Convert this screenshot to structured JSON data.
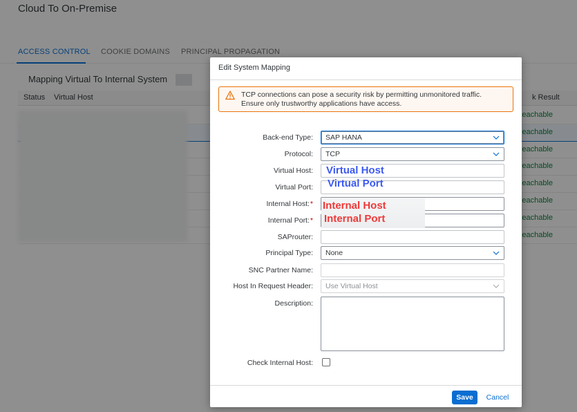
{
  "page": {
    "title": "Cloud To On-Premise",
    "tabs": [
      {
        "label": "ACCESS CONTROL",
        "active": true
      },
      {
        "label": "COOKIE DOMAINS",
        "active": false
      },
      {
        "label": "PRINCIPAL PROPAGATION",
        "active": false
      }
    ],
    "section_title": "Mapping Virtual To Internal System",
    "table_columns": [
      "Status",
      "Virtual Host",
      "k Result"
    ],
    "row_results": [
      "eachable",
      "eachable",
      "eachable",
      "eachable",
      "eachable",
      "eachable",
      "eachable",
      "eachable"
    ]
  },
  "dialog": {
    "title": "Edit System Mapping",
    "warning": {
      "icon": "warning-triangle-icon",
      "color": "#e9730c",
      "text_line1": "TCP connections can pose a security risk by permitting unmonitored traffic.",
      "text_line2": "Ensure only trustworthy applications have access."
    },
    "fields": {
      "backend_type": {
        "label": "Back-end Type:",
        "value": "SAP HANA"
      },
      "protocol": {
        "label": "Protocol:",
        "value": "TCP"
      },
      "virtual_host": {
        "label": "Virtual Host:",
        "annotation": "Virtual Host"
      },
      "virtual_port": {
        "label": "Virtual Port:",
        "annotation": "Virtual Port"
      },
      "internal_host": {
        "label": "Internal Host:",
        "required_mark": "*",
        "annotation": "Internal Host"
      },
      "internal_port": {
        "label": "Internal Port:",
        "required_mark": "*",
        "annotation": "Internal Port"
      },
      "saprouter": {
        "label": "SAProuter:",
        "value": ""
      },
      "principal_type": {
        "label": "Principal Type:",
        "value": "None"
      },
      "snc_partner_name": {
        "label": "SNC Partner Name:",
        "value": ""
      },
      "host_in_request_header": {
        "label": "Host In Request Header:",
        "value": "Use Virtual Host"
      },
      "description": {
        "label": "Description:",
        "value": ""
      },
      "check_internal_host": {
        "label": "Check Internal Host:",
        "checked": false
      }
    },
    "footer": {
      "save_label": "Save",
      "cancel_label": "Cancel"
    },
    "colors": {
      "accent": "#0a6ed1",
      "annotation_blue": "#3d5af1",
      "annotation_red": "#ee3a3a"
    }
  }
}
